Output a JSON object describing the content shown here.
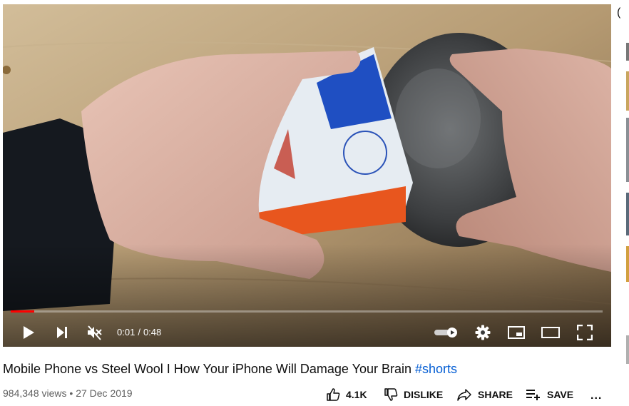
{
  "player": {
    "current_time": "0:01",
    "separator": "/",
    "duration": "0:48",
    "progress_fraction": 0.04,
    "colors": {
      "progress": "#ff0000",
      "controls": "#ffffff"
    }
  },
  "video": {
    "title_text": "Mobile Phone vs Steel Wool I How Your iPhone Will Damage Your Brain",
    "hashtag": "#shorts",
    "views": "984,348 views",
    "bullet": "•",
    "date": "27 Dec 2019"
  },
  "actions": {
    "like_count": "4.1K",
    "dislike_label": "DISLIKE",
    "share_label": "SHARE",
    "save_label": "SAVE",
    "more_glyph": "..."
  },
  "icons": {
    "play": "play-icon",
    "next": "next-icon",
    "mute": "volume-muted-icon",
    "autoplay": "autoplay-toggle-icon",
    "settings": "gear-icon",
    "miniplayer": "miniplayer-icon",
    "theater": "theater-mode-icon",
    "fullscreen": "fullscreen-icon",
    "like": "thumbs-up-icon",
    "dislike": "thumbs-down-icon",
    "share": "share-arrow-icon",
    "save": "playlist-add-icon"
  },
  "colors": {
    "link": "#065fd4",
    "meta_text": "#606060",
    "text": "#0f0f0f"
  },
  "sidebar_glyph": "("
}
